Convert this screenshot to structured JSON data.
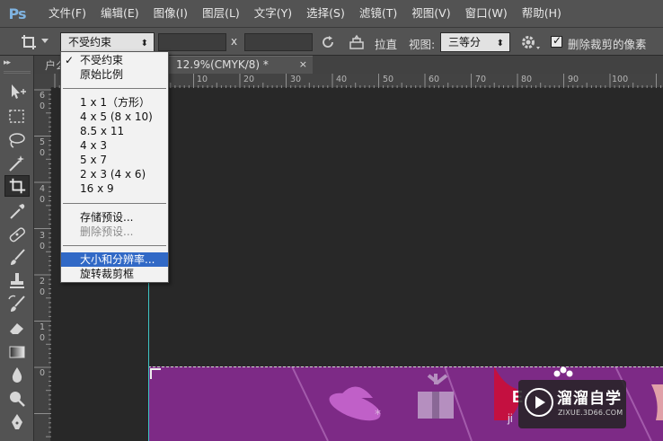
{
  "app": {
    "logo": "Ps"
  },
  "menu": [
    "文件(F)",
    "编辑(E)",
    "图像(I)",
    "图层(L)",
    "文字(Y)",
    "选择(S)",
    "滤镜(T)",
    "视图(V)",
    "窗口(W)",
    "帮助(H)"
  ],
  "options": {
    "ratio_value": "不受约束",
    "swap_symbol": "x",
    "straighten_label": "拉直",
    "view_label": "视图:",
    "view_value": "三等分",
    "delete_pixels_label": "删除裁剪的像素",
    "delete_pixels_checked": true
  },
  "tabs": {
    "inactive_label": "户么",
    "active_label": "12.9%(CMYK/8) *",
    "close_symbol": "×"
  },
  "ruler": {
    "top_labels": [
      "10",
      "20",
      "30",
      "40",
      "50",
      "60",
      "70",
      "80",
      "90",
      "100"
    ],
    "left_labels": [
      "6",
      "0",
      "5",
      "0",
      "4",
      "0",
      "3",
      "0",
      "2",
      "0",
      "1",
      "0",
      "0"
    ]
  },
  "dropdown": {
    "items": [
      {
        "label": "不受约束",
        "checked": true
      },
      {
        "label": "原始比例"
      },
      {
        "label": "1 x 1（方形）"
      },
      {
        "label": "4 x 5 (8 x 10)"
      },
      {
        "label": "8.5 x 11"
      },
      {
        "label": "4 x 3"
      },
      {
        "label": "5 x 7"
      },
      {
        "label": "2 x 3 (4 x 6)"
      },
      {
        "label": "16 x 9"
      },
      {
        "label": "存储预设..."
      },
      {
        "label": "删除预设...",
        "disabled": true
      },
      {
        "label": "大小和分辨率...",
        "highlighted": true
      },
      {
        "label": "旋转裁剪框"
      }
    ]
  },
  "watermark": {
    "title": "溜溜自学",
    "url": "ZIXUE.3D66.COM"
  },
  "colors": {
    "document_fill": "#7d2a86",
    "guide": "#3ec4c4",
    "highlight": "#3169c6"
  }
}
